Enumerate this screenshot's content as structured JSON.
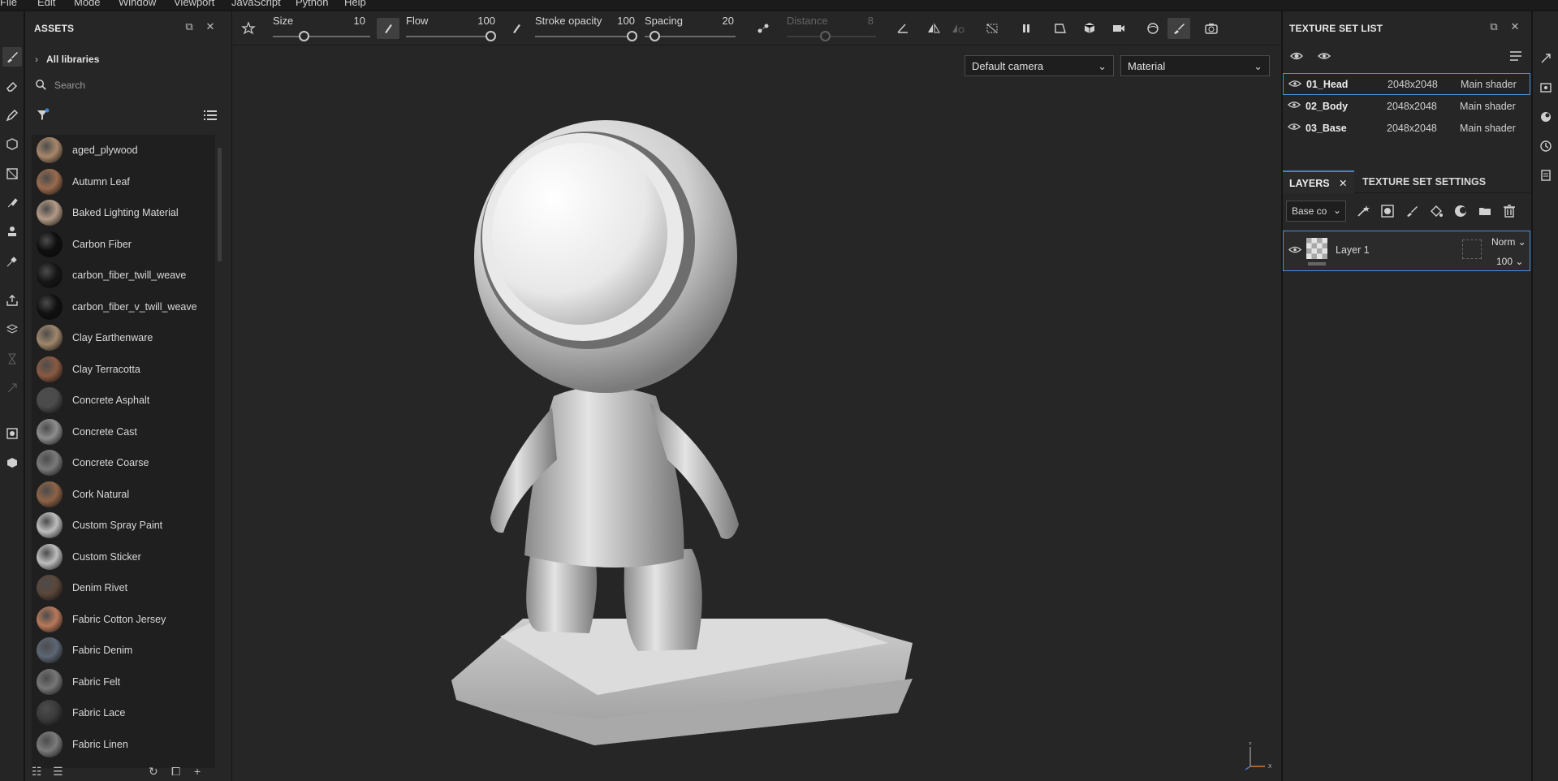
{
  "menu": [
    "File",
    "Edit",
    "Mode",
    "Window",
    "Viewport",
    "JavaScript",
    "Python",
    "Help"
  ],
  "assets": {
    "title": "ASSETS",
    "libraries_label": "All libraries",
    "search_placeholder": "Search",
    "items": [
      {
        "label": "aged_plywood",
        "color": "#a8876a"
      },
      {
        "label": "Autumn Leaf",
        "color": "#9a6b4e"
      },
      {
        "label": "Baked Lighting Material",
        "color": "#b49a86"
      },
      {
        "label": "Carbon Fiber",
        "color": "#0f0f0f"
      },
      {
        "label": "carbon_fiber_twill_weave",
        "color": "#161616"
      },
      {
        "label": "carbon_fiber_v_twill_weave",
        "color": "#111111"
      },
      {
        "label": "Clay Earthenware",
        "color": "#a0876b"
      },
      {
        "label": "Clay Terracotta",
        "color": "#8a5a42"
      },
      {
        "label": "Concrete Asphalt",
        "color": "#4b4b4b"
      },
      {
        "label": "Concrete Cast",
        "color": "#8d8d8d"
      },
      {
        "label": "Concrete Coarse",
        "color": "#7a7a7a"
      },
      {
        "label": "Cork Natural",
        "color": "#8e6347"
      },
      {
        "label": "Custom Spray Paint",
        "color": "#bdbdbd"
      },
      {
        "label": "Custom Sticker",
        "color": "#bdbdbd"
      },
      {
        "label": "Denim Rivet",
        "color": "#5a4639"
      },
      {
        "label": "Fabric Cotton Jersey",
        "color": "#b8795a"
      },
      {
        "label": "Fabric Denim",
        "color": "#5d6675"
      },
      {
        "label": "Fabric Felt",
        "color": "#777777"
      },
      {
        "label": "Fabric Lace",
        "color": "#3b3b3b"
      },
      {
        "label": "Fabric Linen",
        "color": "#7b7b7b"
      }
    ]
  },
  "toolbar": {
    "size_label": "Size",
    "size_value": "10",
    "flow_label": "Flow",
    "flow_value": "100",
    "opacity_label": "Stroke opacity",
    "opacity_value": "100",
    "spacing_label": "Spacing",
    "spacing_value": "20",
    "distance_label": "Distance",
    "distance_value": "8"
  },
  "viewport": {
    "camera": "Default camera",
    "mode": "Material",
    "axis_y": "Y",
    "axis_x": "X"
  },
  "texture_set_list": {
    "title": "TEXTURE SET LIST",
    "rows": [
      {
        "name": "01_Head",
        "resolution": "2048x2048",
        "shader": "Main shader"
      },
      {
        "name": "02_Body",
        "resolution": "2048x2048",
        "shader": "Main shader"
      },
      {
        "name": "03_Base",
        "resolution": "2048x2048",
        "shader": "Main shader"
      }
    ]
  },
  "layers": {
    "tab_layers": "LAYERS",
    "tab_settings": "TEXTURE SET SETTINGS",
    "channel": "Base co",
    "layer_name": "Layer 1",
    "blend": "Norm",
    "opacity": "100"
  }
}
